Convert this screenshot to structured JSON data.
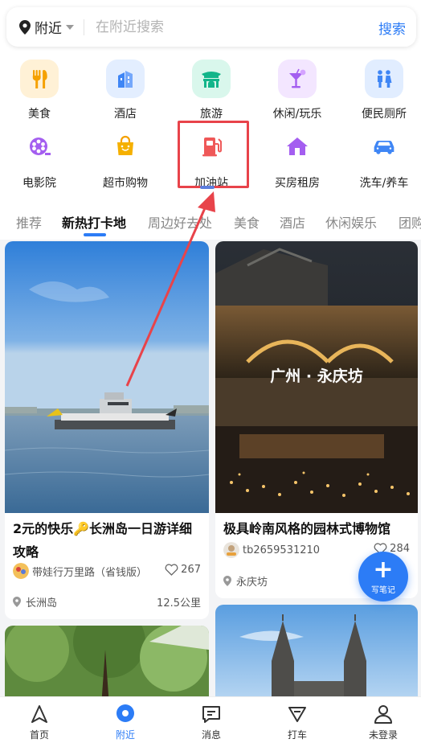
{
  "search": {
    "location_label": "附近",
    "placeholder": "在附近搜索",
    "button_label": "搜索"
  },
  "categories": [
    {
      "label": "美食",
      "icon": "fork-knife-icon"
    },
    {
      "label": "酒店",
      "icon": "hotel-building-icon"
    },
    {
      "label": "旅游",
      "icon": "temple-gate-icon"
    },
    {
      "label": "休闲/玩乐",
      "icon": "cocktail-icon"
    },
    {
      "label": "便民厕所",
      "icon": "restroom-icon"
    },
    {
      "label": "电影院",
      "icon": "film-reel-icon"
    },
    {
      "label": "超市购物",
      "icon": "shopping-bag-icon"
    },
    {
      "label": "加油站",
      "icon": "fuel-pump-icon"
    },
    {
      "label": "买房租房",
      "icon": "house-icon"
    },
    {
      "label": "洗车/养车",
      "icon": "car-icon"
    }
  ],
  "tabs": [
    "推荐",
    "新热打卡地",
    "周边好去处",
    "美食",
    "酒店",
    "休闲娱乐",
    "团购"
  ],
  "active_tab": "新热打卡地",
  "feed": [
    {
      "title": "2元的快乐🔑长洲岛一日游详细攻略",
      "author": "带娃行万里路（省钱版）",
      "likes": "267",
      "place": "长洲岛",
      "distance": "12.5公里"
    },
    {
      "title": "极具岭南风格的园林式博物馆",
      "author": "tb2659531210",
      "likes": "284",
      "place": "永庆坊",
      "image_caption": "广州 · 永庆坊"
    }
  ],
  "fab": {
    "label": "写笔记"
  },
  "nav": [
    {
      "label": "首页",
      "icon": "navigation-arrow-icon"
    },
    {
      "label": "附近",
      "icon": "location-pin-icon"
    },
    {
      "label": "消息",
      "icon": "message-icon"
    },
    {
      "label": "打车",
      "icon": "taxi-icon"
    },
    {
      "label": "未登录",
      "icon": "user-icon"
    }
  ],
  "active_nav": "附近",
  "colors": {
    "accent": "#2c7cf6",
    "highlight": "#e8434a"
  }
}
